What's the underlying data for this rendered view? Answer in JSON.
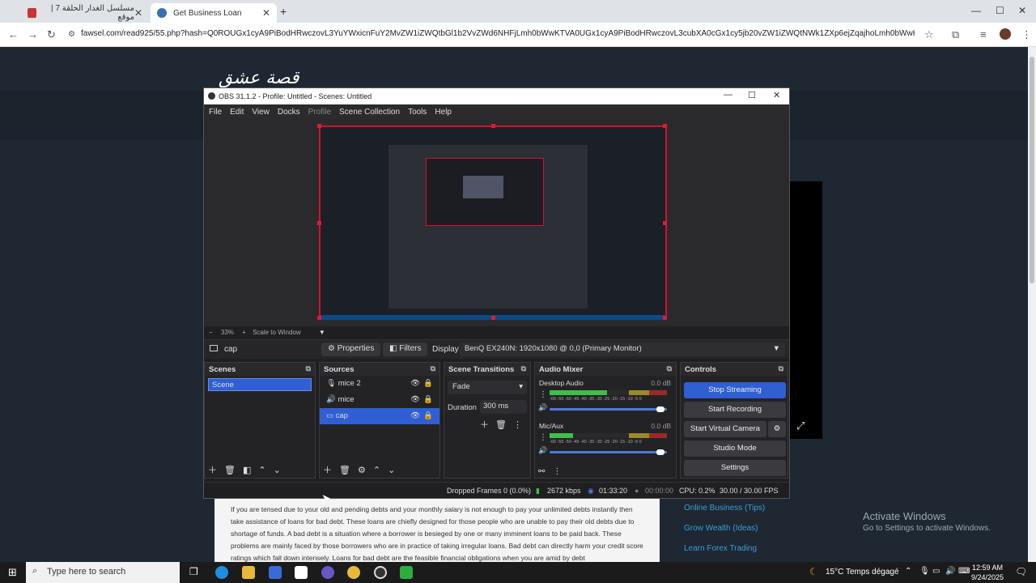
{
  "browser": {
    "tabs": [
      {
        "label": "مسلسل الغدار الحلقة 7 | موقع"
      },
      {
        "label": "Get Business Loan"
      }
    ],
    "url": "fawsel.com/read925/55.php?hash=Q0ROUGx1cyA9PiBodHRwczovL3YuYWxicnFuY2MvZW1iZWQtbGl1b2VvZWd6NHFjLmh0bWwKTVA0UGx1cyA9PiBodHRwczovL3cubXA0cGx1cy5jb20vZW1iZWQtNWk1ZXp6ejZqajhoLmh0bWwKYW5hdHVyayA9PiBo..."
  },
  "page": {
    "site_logo": "قصة عشق",
    "article_text": "If you are tensed due to your old and pending debts and your monthly salary is not enough to pay your unlimited debts instantly then take assistance of loans for bad debt. These loans are chiefly designed for those people who are unable to pay their old debts due to shortage of funds. A bad debt is a situation where a borrower is besieged by one or many imminent loans to be paid back. These problems are mainly faced by those borrowers who are in practice of taking irregular loans. Bad debt can directly harm your credit score ratings which fall down intensely. Loans for bad debt are the feasible financial obligations when you are amid by debt",
    "side_links": [
      "Online Business (Tips)",
      "Grow Wealth (Ideas)",
      "Learn Forex Trading"
    ],
    "activate_title": "Activate Windows",
    "activate_sub": "Go to Settings to activate Windows."
  },
  "obs": {
    "title": "OBS 31.1.2 - Profile: Untitled - Scenes: Untitled",
    "menu": [
      "File",
      "Edit",
      "View",
      "Docks",
      "Profile",
      "Scene Collection",
      "Tools",
      "Help"
    ],
    "zoom": "33%",
    "scale_label": "Scale to Window",
    "source_bar": {
      "selected_source": "cap",
      "properties": "Properties",
      "filters": "Filters",
      "display_label": "Display",
      "display_value": "BenQ EX240N: 1920x1080 @ 0,0 (Primary Monitor)"
    },
    "scenes": {
      "header": "Scenes",
      "items": [
        "Scene"
      ]
    },
    "sources": {
      "header": "Sources",
      "items": [
        "mice 2",
        "mice",
        "cap"
      ]
    },
    "transitions": {
      "header": "Scene Transitions",
      "type": "Fade",
      "duration_label": "Duration",
      "duration_value": "300 ms"
    },
    "audio": {
      "header": "Audio Mixer",
      "channels": [
        {
          "name": "Desktop Audio",
          "db": "0.0 dB",
          "level": 0.49
        },
        {
          "name": "Mic/Aux",
          "db": "0.0 dB",
          "level": 0.2
        }
      ],
      "scale": "-60 -55 -50 -45 -40 -35 -30 -25 -20 -15 -10 -5 0"
    },
    "controls": {
      "header": "Controls",
      "buttons": [
        "Stop Streaming",
        "Start Recording",
        "Start Virtual Camera",
        "Studio Mode",
        "Settings"
      ]
    },
    "status": {
      "dropped": "Dropped Frames 0 (0.0%)",
      "bitrate": "2672 kbps",
      "stream_time": "01:33:20",
      "rec_time": "00:00:00",
      "cpu": "CPU: 0.2%",
      "fps": "30.00 / 30.00 FPS"
    }
  },
  "taskbar": {
    "search_placeholder": "Type here to search",
    "weather": "15°C  Temps dégagé",
    "time": "12:59 AM",
    "date": "9/24/2025"
  },
  "colors": {
    "accent": "#2f5fd2",
    "selection_border": "#d7102e"
  }
}
